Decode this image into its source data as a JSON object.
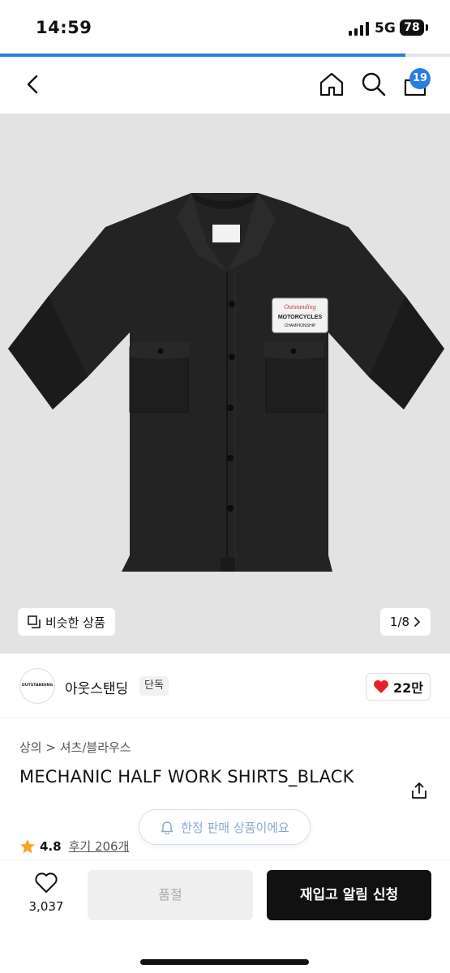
{
  "status_bar": {
    "time": "14:59",
    "network": "5G",
    "battery": "78"
  },
  "page_progress": 0.9,
  "nav": {
    "cart_count": "19"
  },
  "gallery": {
    "similar_label": "비슷한 상품",
    "counter": "1/8",
    "patch_lines": [
      "Outstanding",
      "MOTORCYCLES",
      "CHAMPIONSHIP"
    ]
  },
  "brand": {
    "logo_text": "OUTSTANDING",
    "name": "아웃스탠딩",
    "tag": "단독",
    "likes": "22만"
  },
  "product": {
    "breadcrumb_1": "상의",
    "breadcrumb_2": "셔츠/블라우스",
    "title": "MECHANIC HALF WORK SHIRTS_BLACK",
    "limited_notice": "한정 판매 상품이에요",
    "rating": "4.8",
    "reviews": "후기 206개"
  },
  "bottom_bar": {
    "wish_count": "3,037",
    "soldout_label": "품절",
    "restock_label": "재입고 알림 신청"
  },
  "colors": {
    "accent": "#2a7de1",
    "like_red": "#e8212e",
    "star": "#f5a623"
  }
}
